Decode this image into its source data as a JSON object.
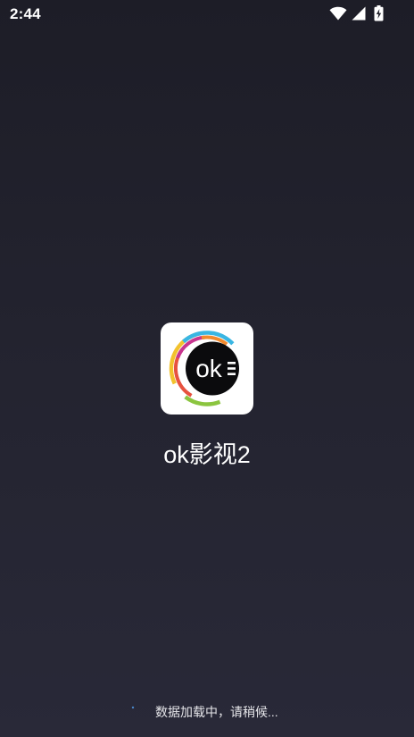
{
  "status_bar": {
    "time": "2:44",
    "icons": [
      "wifi-icon",
      "cell-signal-icon",
      "battery-charging-icon"
    ]
  },
  "splash": {
    "app_icon": "ok-logo-icon",
    "logo_text": "ok",
    "app_name": "ok影视2"
  },
  "loading": {
    "indicator": "spinner-icon",
    "message": "数据加载中，请稍候..."
  },
  "colors": {
    "background_top": "#1d1d27",
    "background_bottom": "#292938",
    "spinner": "#4a86c8"
  }
}
